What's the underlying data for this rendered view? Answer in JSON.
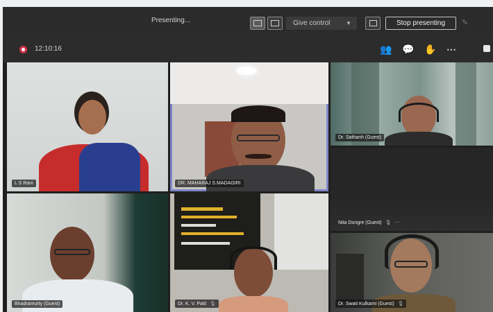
{
  "presenting_bar": {
    "status": "Presenting...",
    "give_control": "Give control",
    "stop_presenting": "Stop presenting"
  },
  "meeting_bar": {
    "timer": "12:10:16",
    "icons": [
      "participants-icon",
      "chat-icon",
      "raise-hand-icon",
      "more-icon",
      "camera-icon"
    ]
  },
  "participants": [
    {
      "name": "L S Rani"
    },
    {
      "name": "DR. MAHARAJ S.MADAGIRI"
    },
    {
      "name": "Dr. Sathanh (Guest)"
    },
    {
      "name": "Nita Dongre (Guest)"
    },
    {
      "name": "Bhadramurty (Guest)"
    },
    {
      "name": "Dr. K. V. Patil"
    },
    {
      "name": "Dr. Swati Kulkarni (Guest)"
    }
  ],
  "colors": {
    "recording": "#d0324b",
    "active_speaker": "#7f85c8"
  }
}
